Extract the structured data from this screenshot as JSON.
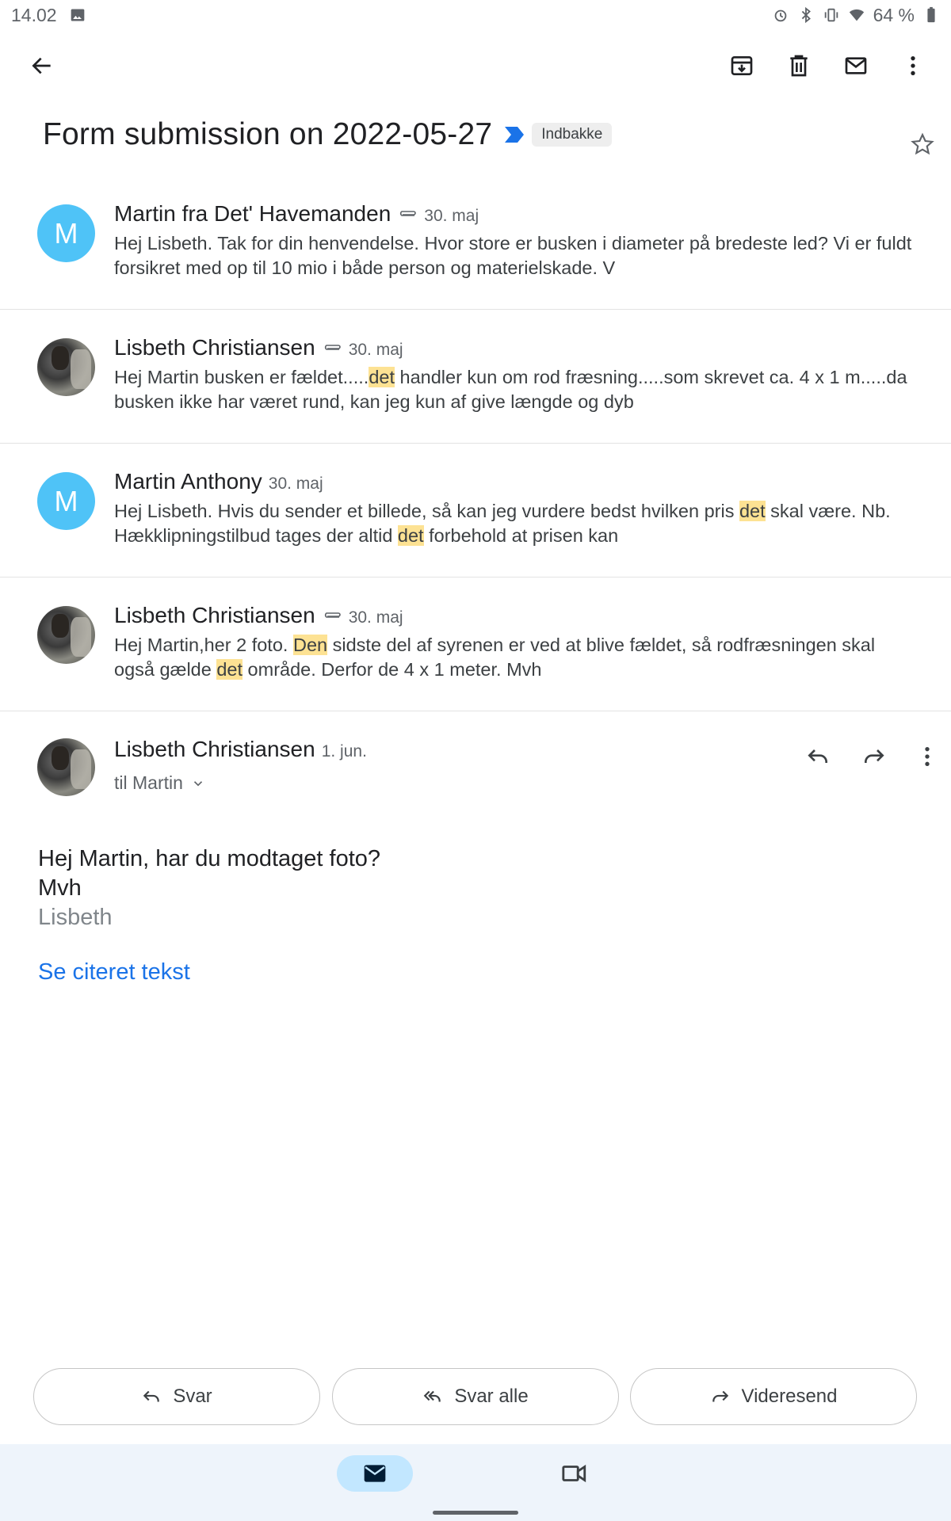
{
  "status_bar": {
    "time": "14.02",
    "battery": "64 %"
  },
  "subject": {
    "title": "Form submission on 2022-05-27",
    "label": "Indbakke"
  },
  "messages": [
    {
      "sender": "Martin fra Det' Havemanden",
      "avatar_letter": "M",
      "has_attachment": true,
      "date": "30. maj",
      "snippet": "Hej Lisbeth. Tak for din henvendelse. Hvor store er busken i diameter på bredeste led? Vi er fuldt forsikret med op til 10 mio i både person og materielskade. V"
    },
    {
      "sender": "Lisbeth Christiansen",
      "has_attachment": true,
      "date": "30. maj",
      "snippet_parts": [
        "Hej Martin busken er fældet.....",
        "det",
        " handler kun om rod fræsning.....som skrevet ca. 4 x 1 m.....da busken ikke har været rund, kan jeg kun af give længde og dyb"
      ]
    },
    {
      "sender": "Martin Anthony",
      "avatar_letter": "M",
      "has_attachment": false,
      "date": "30. maj",
      "snippet_parts": [
        "Hej Lisbeth. Hvis du sender et billede, så kan jeg vurdere bedst hvilken pris ",
        "det",
        " skal være. Nb. Hækklipningstilbud tages der altid ",
        "det",
        " forbehold at prisen kan"
      ]
    },
    {
      "sender": "Lisbeth Christiansen",
      "has_attachment": true,
      "date": "30. maj",
      "snippet_parts": [
        "Hej Martin,her 2 foto. ",
        "Den",
        " sidste del af syrenen er ved at blive fældet, så rodfræsningen skal også gælde ",
        "det",
        " område. Derfor de 4 x 1 meter. Mvh"
      ]
    }
  ],
  "expanded": {
    "sender": "Lisbeth Christiansen",
    "date": "1. jun.",
    "to": "til Martin",
    "body_line1": "Hej Martin, har du modtaget foto?",
    "body_line2": "Mvh",
    "body_line3": "Lisbeth",
    "quoted_link": "Se citeret tekst"
  },
  "actions": {
    "reply": "Svar",
    "reply_all": "Svar alle",
    "forward": "Videresend"
  },
  "colors": {
    "accent": "#1a73e8",
    "highlight": "#fde293",
    "avatar": "#4fc3f7",
    "nav_bg": "#eef4fb",
    "nav_active": "#c2e7ff"
  }
}
